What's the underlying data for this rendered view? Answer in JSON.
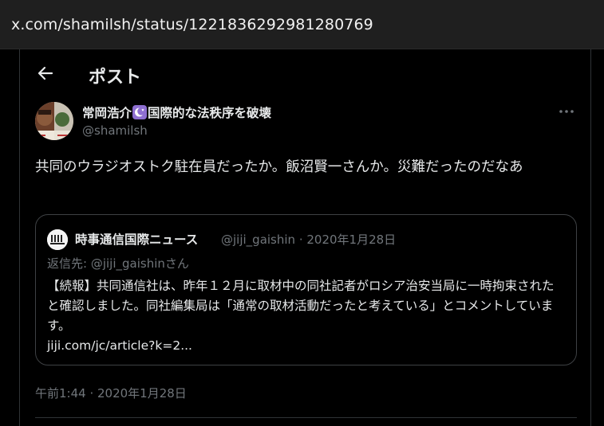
{
  "browser": {
    "url": "x.com/shamilsh/status/1221836292981280769"
  },
  "header": {
    "title": "ポスト",
    "back_icon": "arrow-left-icon"
  },
  "author": {
    "name_part1": "常岡浩介",
    "badge_icon": "crescent-moon-icon",
    "name_part2": "国際的な法秩序を破壊",
    "handle": "@shamilsh",
    "more_icon": "more-horizontal-icon"
  },
  "tweet": {
    "text": "共同のウラジオストク駐在員だったか。飯沼賢一さんか。災難だったのだなあ",
    "timestamp": "午前1:44 · 2020年1月28日"
  },
  "quote": {
    "name": "時事通信国際ニュース",
    "meta": "@jiji_gaishin · 2020年1月28日",
    "reply_to": "返信先: @jiji_gaishinさん",
    "body": "【続報】共同通信社は、昨年１２月に取材中の同社記者がロシア治安当局に一時拘束されたと確認しました。同社編集局は「通常の取材活動だったと考えている」とコメントしています。",
    "link": "jiji.com/jc/article?k=2..."
  },
  "colors": {
    "background": "#000000",
    "text": "#e7e9ea",
    "muted": "#71767b",
    "border": "#2f3336",
    "badge": "#8e6fd1"
  }
}
